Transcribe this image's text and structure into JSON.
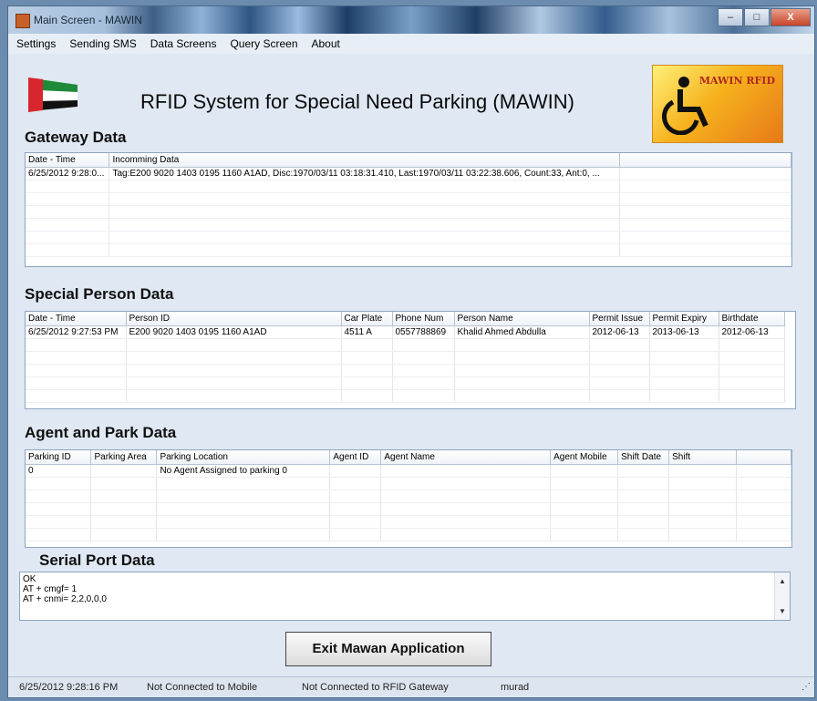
{
  "window": {
    "title": "Main Screen - MAWIN",
    "minimize": "–",
    "maximize": "□",
    "close": "X"
  },
  "menu": [
    "Settings",
    "Sending SMS",
    "Data Screens",
    "Query Screen",
    "About"
  ],
  "header": {
    "title": "RFID System for Special Need Parking (MAWIN)",
    "logo_text": "MAWIN RFID"
  },
  "gateway": {
    "title": "Gateway Data",
    "columns": [
      "Date - Time",
      "Incomming Data",
      ""
    ],
    "rows": [
      [
        "6/25/2012 9:28:0...",
        "Tag:E200 9020 1403 0195 1160 A1AD, Disc:1970/03/11 03:18:31.410, Last:1970/03/11 03:22:38.606, Count:33, Ant:0, ...",
        ""
      ]
    ]
  },
  "person": {
    "title": "Special Person Data",
    "columns": [
      "Date - Time",
      "Person ID",
      "Car Plate",
      "Phone Num",
      "Person Name",
      "Permit Issue",
      "Permit Expiry",
      "Birthdate"
    ],
    "rows": [
      [
        "6/25/2012 9:27:53 PM",
        "E200 9020 1403 0195 1160 A1AD",
        "4511 A",
        "0557788869",
        "Khalid Ahmed Abdulla",
        "2012-06-13",
        "2013-06-13",
        "2012-06-13"
      ]
    ]
  },
  "agent": {
    "title": "Agent and Park Data",
    "columns": [
      "Parking ID",
      "Parking Area",
      "Parking Location",
      "Agent ID",
      "Agent Name",
      "Agent Mobile",
      "Shift Date",
      "Shift",
      ""
    ],
    "rows": [
      [
        "0",
        "",
        "No Agent Assigned to parking 0",
        "",
        "",
        "",
        "",
        "",
        ""
      ]
    ]
  },
  "serial": {
    "title": "Serial Port Data",
    "lines": [
      "OK",
      "AT  + cmgf= 1",
      "AT  + cnmi= 2,2,0,0,0"
    ]
  },
  "exit_label": "Exit Mawan Application",
  "status": {
    "time": "6/25/2012 9:28:16 PM",
    "mobile": "Not Connected to Mobile",
    "gateway": "Not Connected to RFID Gateway",
    "user": "murad"
  }
}
